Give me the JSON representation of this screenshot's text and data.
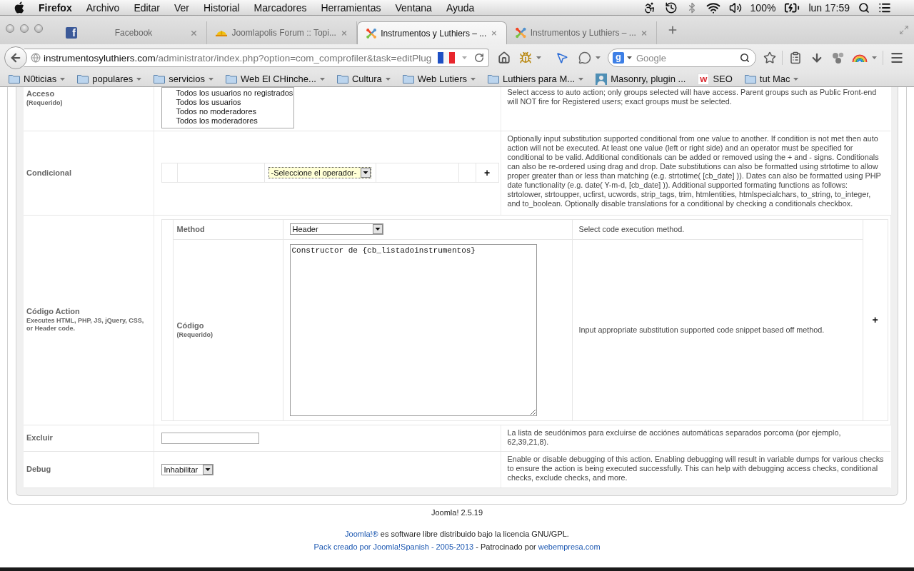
{
  "menubar": {
    "app": "Firefox",
    "menus": [
      "Archivo",
      "Editar",
      "Ver",
      "Historial",
      "Marcadores",
      "Herramientas",
      "Ventana",
      "Ayuda"
    ],
    "battery": "100%",
    "clock": "lun 17:59"
  },
  "tabs": [
    {
      "title": "Facebook",
      "kind": "square",
      "badge": "f",
      "selected": false
    },
    {
      "title": "Joomlapolis Forum :: Topi...",
      "kind": "helmet",
      "selected": false
    },
    {
      "title": "Instrumentos y Luthiers – ...",
      "kind": "pinwheel",
      "selected": true
    },
    {
      "title": "Instrumentos y Luthiers – ...",
      "kind": "pinwheel",
      "selected": false
    }
  ],
  "address": {
    "host": "instrumentosyluthiers.com",
    "path": "/administrator/index.php?option=com_comprofiler&task=editPlug"
  },
  "search": {
    "engine_badge": "g",
    "placeholder": "Google"
  },
  "bookmarks": [
    {
      "label": "N0ticias",
      "kind": "folder"
    },
    {
      "label": "populares",
      "kind": "folder"
    },
    {
      "label": "servicios",
      "kind": "folder"
    },
    {
      "label": "Web El CHinche...",
      "kind": "folder"
    },
    {
      "label": "Cultura",
      "kind": "folder"
    },
    {
      "label": "Web Lutiers",
      "kind": "folder"
    },
    {
      "label": "Luthiers para M...",
      "kind": "folder"
    },
    {
      "label": "Masonry, plugin ...",
      "kind": "avatar"
    },
    {
      "label": "SEO",
      "kind": "badge",
      "badge": "w"
    },
    {
      "label": "tut Mac",
      "kind": "folder"
    }
  ],
  "form": {
    "rows": [
      {
        "kind": "listbox",
        "label": "Acceso",
        "note": "(Requerido)",
        "options": [
          "Todos los usuarios no registrados",
          "Todos los usuarios",
          "Todos no moderadores",
          "Todos los moderadores"
        ],
        "description": "Select access to auto action; only groups selected will have access. Parent groups such as Public Front-end will NOT fire for Registered users; exact groups must be selected."
      },
      {
        "kind": "conditional",
        "label": "Condicional",
        "operator": {
          "value": "-Seleccione el operador-",
          "highlighted": true
        },
        "add": "+",
        "description": "Optionally input substitution supported conditional from one value to another. If condition is not met then auto action will not be executed. At least one value (left or right side) and an operator must be specified for conditional to be valid. Additional conditionals can be added or removed using the + and - signs. Conditionals can also be re-ordered using drag and drop. Date substitutions can also be formatted using strtotime to allow proper greater than or less than matching (e.g. strtotime( [cb_date] )). Dates can also be formatted using PHP date functionality (e.g. date( Y-m-d, [cb_date] )). Additional supported formating functions as follows: strtolower, strtoupper, ucfirst, ucwords, strip_tags, trim, htmlentities, htmlspecialchars, to_string, to_integer, and to_boolean. Optionally disable translations for a conditional by checking a conditionals checkbox."
      },
      {
        "kind": "code",
        "label": "Código Action",
        "note": "Executes HTML, PHP, JS, jQuery, CSS, or Header code.",
        "method": {
          "label": "Method",
          "value": "Header",
          "description": "Select code execution method."
        },
        "code": {
          "label": "Código",
          "note": "(Requerido)",
          "value": "Constructor de {cb_listadoinstrumentos}",
          "description": "Input appropriate substitution supported code snippet based off method."
        },
        "add": "+"
      },
      {
        "kind": "text",
        "label": "Excluir",
        "description": "La lista de seudónimos para excluirse de acciónes automáticas separados porcoma (por ejemplo, 62,39,21,8)."
      },
      {
        "kind": "select",
        "label": "Debug",
        "value": "Inhabilitar",
        "description": "Enable or disable debugging of this action. Enabling debugging will result in variable dumps for various checks to ensure the action is being executed successfully. This can help with debugging access checks, conditional checks, exclude checks, and more."
      }
    ]
  },
  "footer": {
    "version": "Joomla! 2.5.19",
    "lines": [
      [
        {
          "text": "Joomla!®",
          "link": true
        },
        {
          "text": " es software libre distribuido bajo la licencia GNU/GPL.",
          "link": false
        }
      ],
      [
        {
          "text": "Pack creado por Joomla!Spanish - 2005-2013",
          "link": true
        },
        {
          "text": " - Patrocinado por ",
          "link": false
        },
        {
          "text": "webempresa.com",
          "link": true
        }
      ]
    ]
  }
}
